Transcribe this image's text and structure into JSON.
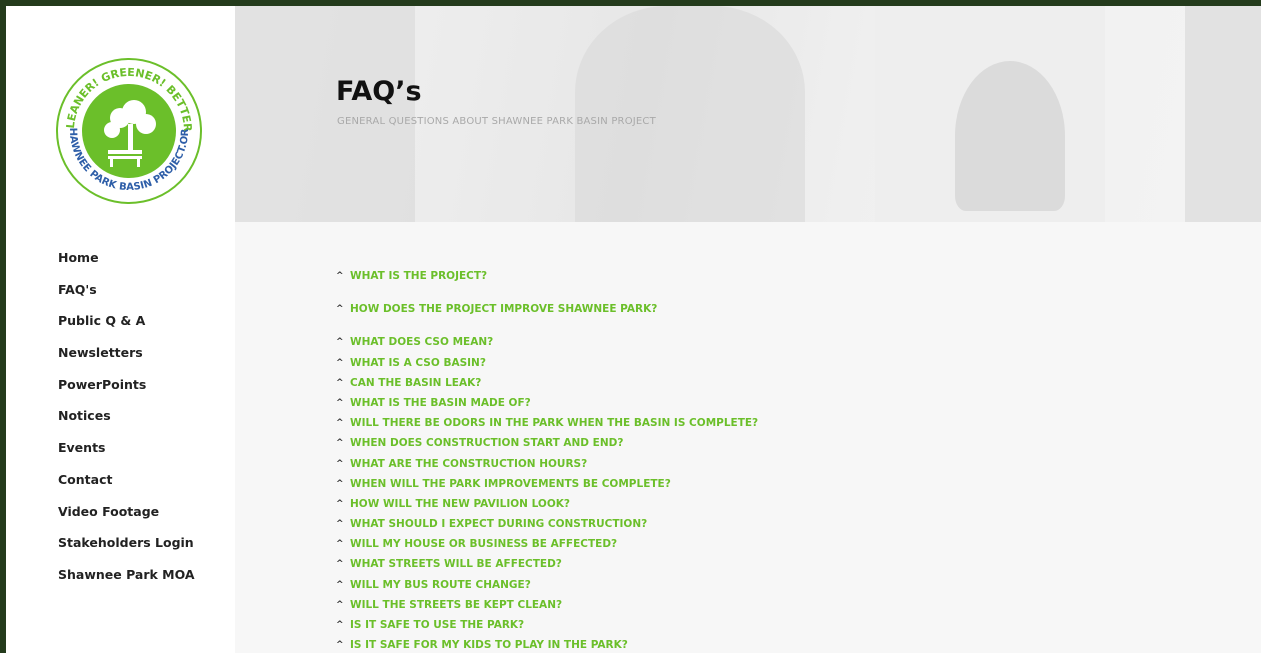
{
  "logo": {
    "ring_text_top": "CLEANER! GREENER! BETTER!",
    "ring_text_bottom": "SHAWNEE PARK BASIN PROJECT.ORG",
    "colors": {
      "green": "#6bbf2a",
      "blue": "#2e5ea8"
    }
  },
  "nav": {
    "items": [
      {
        "label": "Home"
      },
      {
        "label": "FAQ's"
      },
      {
        "label": "Public Q & A"
      },
      {
        "label": "Newsletters"
      },
      {
        "label": "PowerPoints"
      },
      {
        "label": "Notices"
      },
      {
        "label": "Events"
      },
      {
        "label": "Contact"
      },
      {
        "label": "Video Footage"
      },
      {
        "label": "Stakeholders Login"
      },
      {
        "label": "Shawnee Park MOA"
      }
    ]
  },
  "header": {
    "title": "FAQ’s",
    "subtitle": "GENERAL QUESTIONS ABOUT SHAWNEE PARK BASIN PROJECT"
  },
  "faq": {
    "caret_icon": "chevron-up-icon",
    "accent_color": "#6bbf2a",
    "items": [
      {
        "question": "WHAT IS THE PROJECT?"
      },
      {
        "question": "HOW DOES THE PROJECT IMPROVE SHAWNEE PARK?"
      },
      {
        "question": "WHAT DOES CSO MEAN?"
      },
      {
        "question": "WHAT IS A CSO BASIN?"
      },
      {
        "question": "CAN THE BASIN LEAK?"
      },
      {
        "question": "WHAT IS THE BASIN MADE OF?"
      },
      {
        "question": "WILL THERE BE ODORS IN THE PARK WHEN THE BASIN IS COMPLETE?"
      },
      {
        "question": "WHEN DOES CONSTRUCTION START AND END?"
      },
      {
        "question": "WHAT ARE THE CONSTRUCTION HOURS?"
      },
      {
        "question": "WHEN WILL THE PARK IMPROVEMENTS BE COMPLETE?"
      },
      {
        "question": "HOW WILL THE NEW PAVILION LOOK?"
      },
      {
        "question": "WHAT SHOULD I EXPECT DURING CONSTRUCTION?"
      },
      {
        "question": "WILL MY HOUSE OR BUSINESS BE AFFECTED?"
      },
      {
        "question": "WHAT STREETS WILL BE AFFECTED?"
      },
      {
        "question": "WILL MY BUS ROUTE CHANGE?"
      },
      {
        "question": "WILL THE STREETS BE KEPT CLEAN?"
      },
      {
        "question": "IS IT SAFE TO USE THE PARK?"
      },
      {
        "question": "IS IT SAFE FOR MY KIDS TO PLAY IN THE PARK?"
      }
    ]
  }
}
